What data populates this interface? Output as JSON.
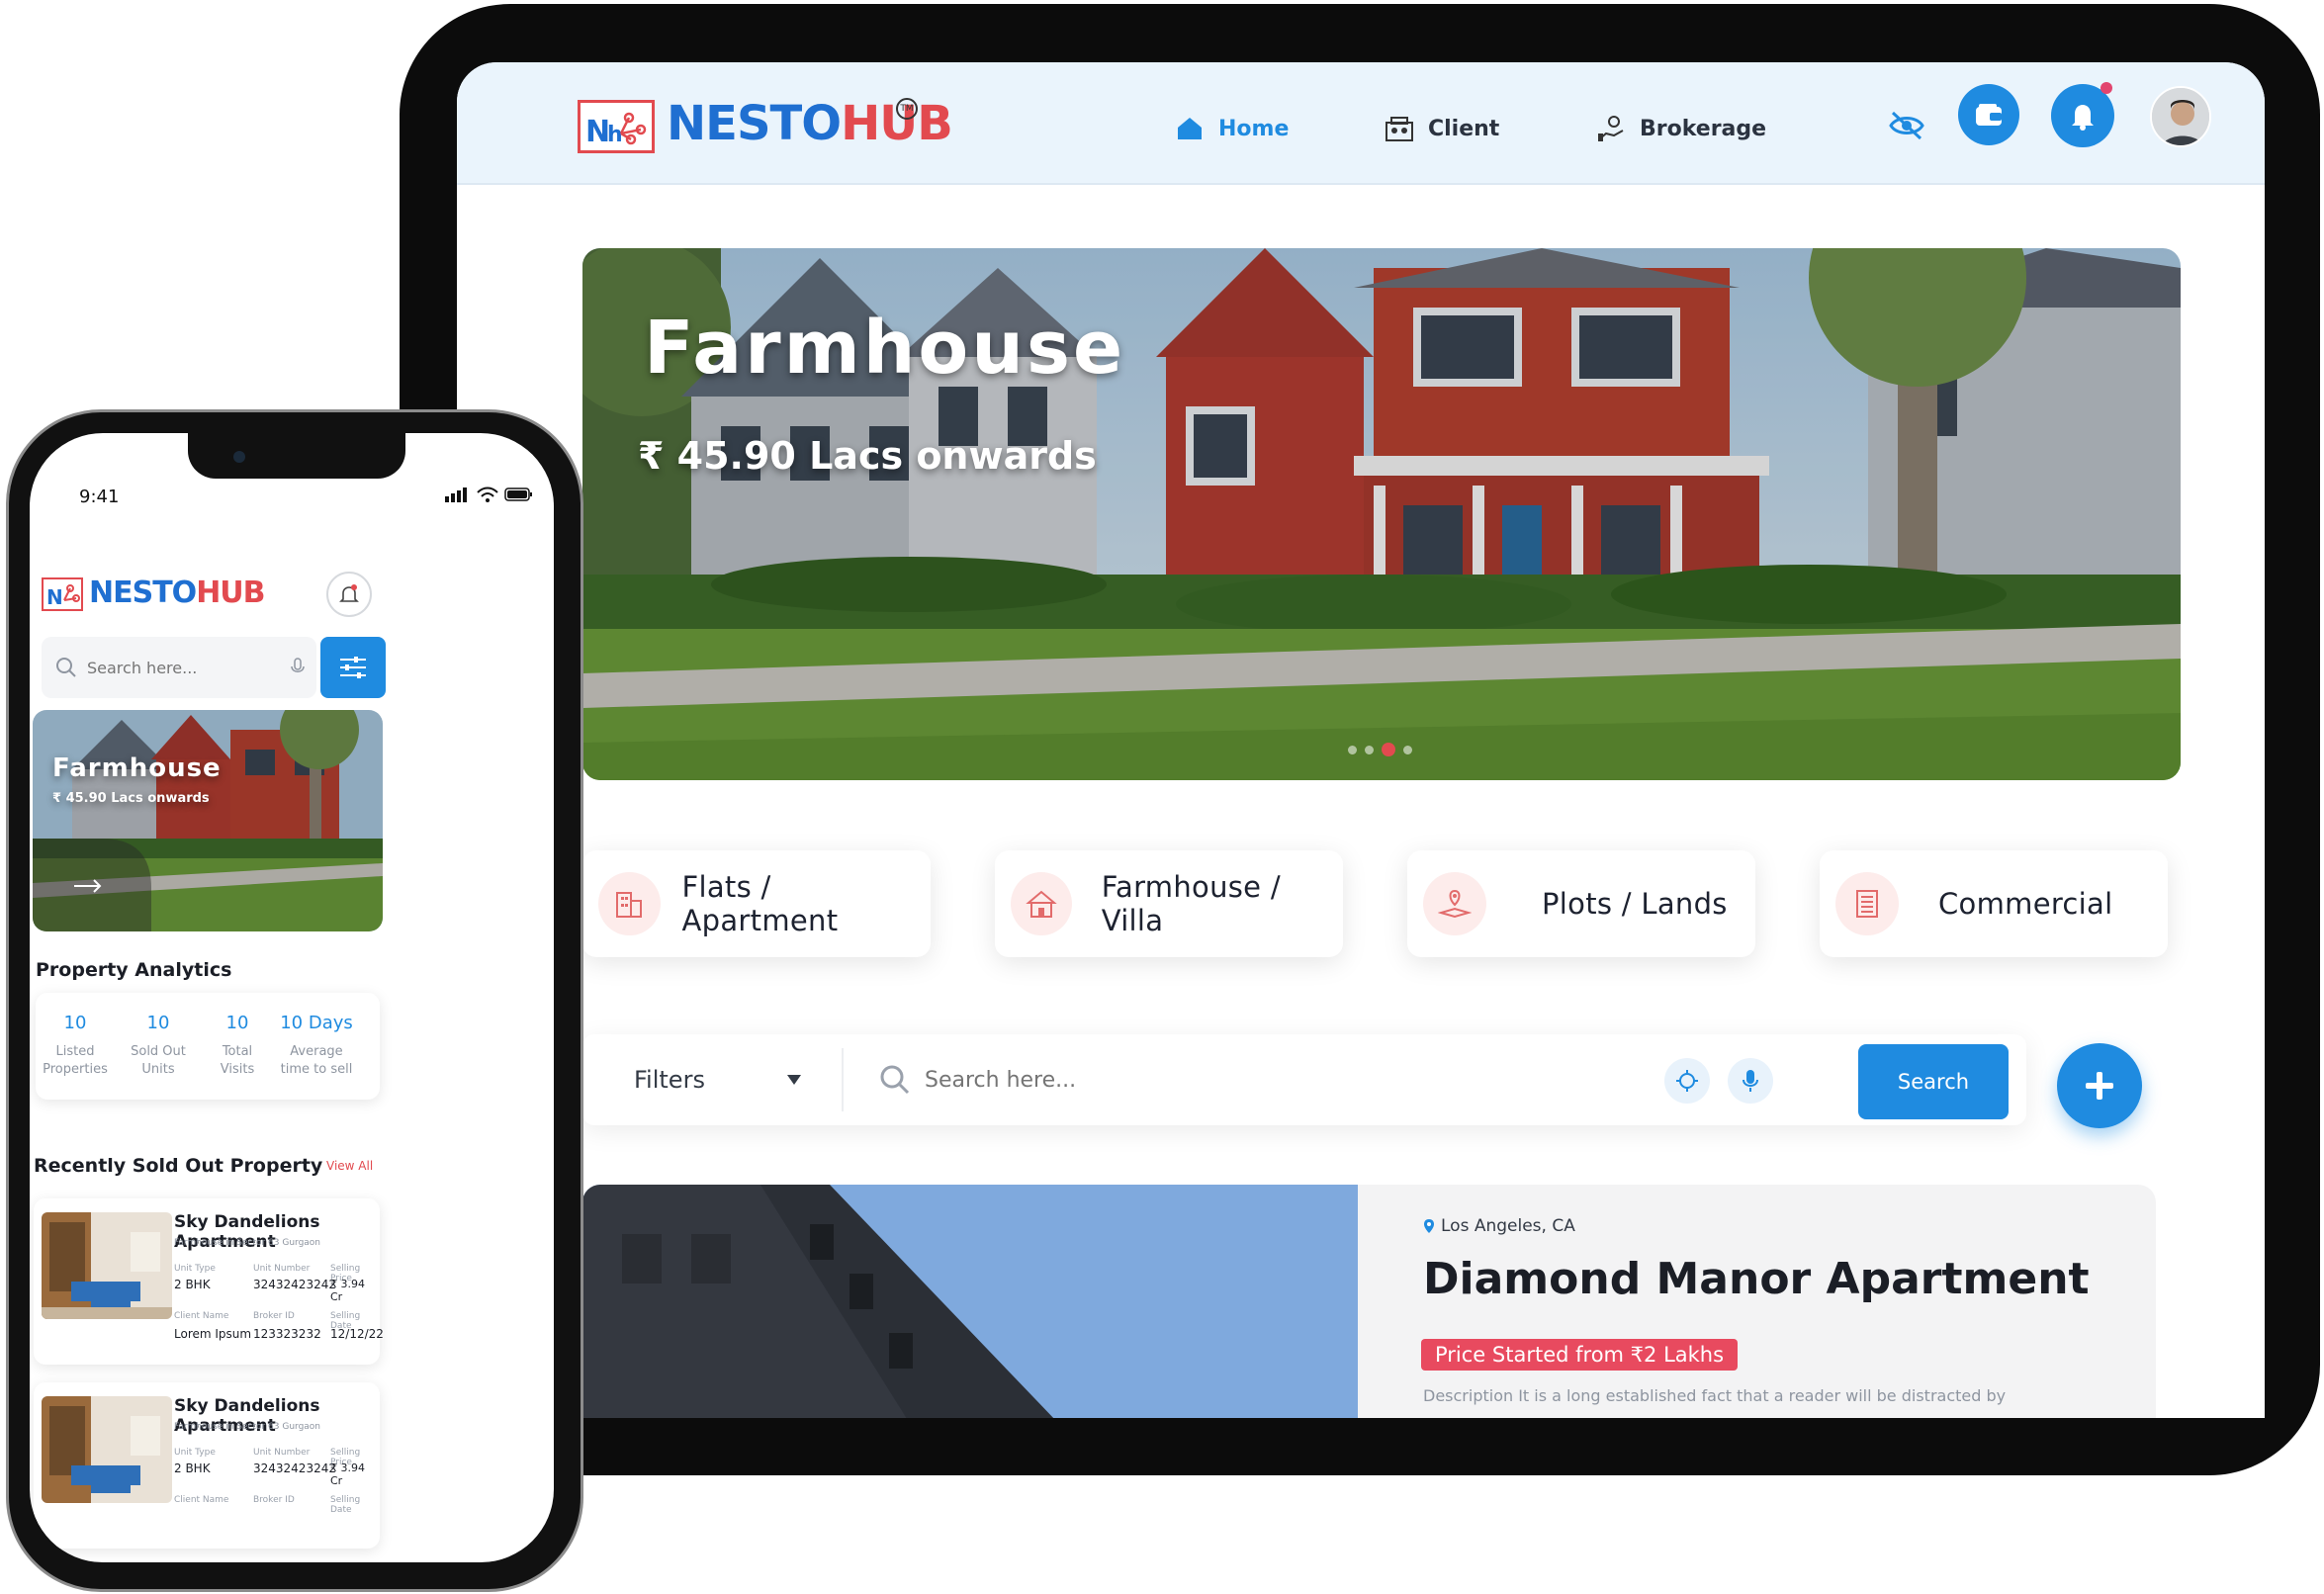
{
  "tablet": {
    "brand": {
      "name": "NESTOHUB",
      "mark": "TM"
    },
    "nav": [
      {
        "label": "Home",
        "icon": "home-icon",
        "active": true
      },
      {
        "label": "Client",
        "icon": "client-icon",
        "active": false
      },
      {
        "label": "Brokerage",
        "icon": "brokerage-icon",
        "active": false
      }
    ],
    "hero": {
      "title": "Farmhouse",
      "price": "₹ 45.90 Lacs onwards",
      "slides": 4,
      "active_slide": 3
    },
    "categories": [
      {
        "label": "Flats / Apartment",
        "icon": "apartment-icon"
      },
      {
        "label": "Farmhouse / Villa",
        "icon": "villa-icon"
      },
      {
        "label": "Plots / Lands",
        "icon": "plot-icon"
      },
      {
        "label": "Commercial",
        "icon": "commercial-icon"
      }
    ],
    "search": {
      "filter_label": "Filters",
      "placeholder": "Search here...",
      "button": "Search"
    },
    "listing": {
      "location": "Los Angeles, CA",
      "title": "Diamond Manor Apartment",
      "price_tag": "Price Started from ₹2 Lakhs",
      "description": "Description It is a long established fact that a reader will be distracted by"
    },
    "colors": {
      "accent": "#1f8be0",
      "brand_red": "#e24a4f",
      "nav_bg": "#eaf4fc"
    }
  },
  "phone": {
    "status": {
      "time": "9:41"
    },
    "brand": "NESTOHUB",
    "search_placeholder": "Search here...",
    "hero": {
      "title": "Farmhouse",
      "price": "₹ 45.90 Lacs onwards"
    },
    "analytics": {
      "title": "Property Analytics",
      "stats": [
        {
          "value": "10",
          "label1": "Listed",
          "label2": "Properties"
        },
        {
          "value": "10",
          "label1": "Sold Out",
          "label2": "Units"
        },
        {
          "value": "10",
          "label1": "Total",
          "label2": "Visits"
        },
        {
          "value": "10 Days",
          "label1": "Average",
          "label2": "time to sell"
        }
      ]
    },
    "recent": {
      "title": "Recently Sold Out Property",
      "view_all": "View All",
      "items": [
        {
          "title": "Sky Dandelions Apartment",
          "subtitle": "Farmhouse in Sector 63 Gurgaon",
          "unit_type_label": "Unit Type",
          "unit_type": "2 BHK",
          "unit_number_label": "Unit Number",
          "unit_number": "32432423242",
          "price_label": "Selling Price",
          "price": "₹ 3.94 Cr",
          "client_label": "Client Name",
          "client": "Lorem Ipsum",
          "broker_label": "Broker ID",
          "broker": "123323232",
          "date_label": "Selling Date",
          "date": "12/12/22"
        },
        {
          "title": "Sky Dandelions Apartment",
          "subtitle": "Farmhouse in Sector 63 Gurgaon",
          "unit_type_label": "Unit Type",
          "unit_type": "2 BHK",
          "unit_number_label": "Unit Number",
          "unit_number": "32432423242",
          "price_label": "Selling Price",
          "price": "₹ 3.94 Cr",
          "client_label": "Client Name",
          "broker_label": "Broker ID",
          "date_label": "Selling Date"
        }
      ]
    }
  }
}
